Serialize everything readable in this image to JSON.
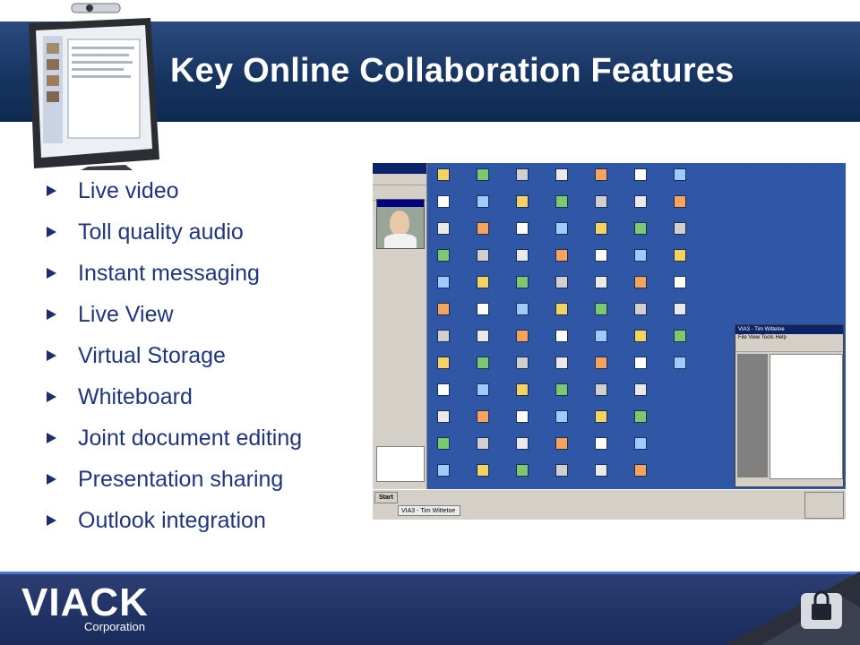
{
  "slide": {
    "title": "Key Online Collaboration Features",
    "bullets": [
      "Live video",
      "Toll quality audio",
      "Instant messaging",
      "Live View",
      "Virtual Storage",
      "Whiteboard",
      "Joint document editing",
      "Presentation sharing",
      "Outlook integration"
    ]
  },
  "screenshot": {
    "via3_window_title": "VIA3 - Tim Wittetoe",
    "via3_menu": "File  View  Tools  Help",
    "taskbar_start": "Start",
    "taskbar_task": "VIA3 - Tim Wittetoe",
    "desktop_color": "#2f57a5"
  },
  "footer": {
    "logo_word": "VIACK",
    "logo_sub": "Corporation"
  },
  "colors": {
    "title_band": "#16335f",
    "bullet_text": "#1f3580",
    "bottom_band": "#1a2b5c"
  }
}
